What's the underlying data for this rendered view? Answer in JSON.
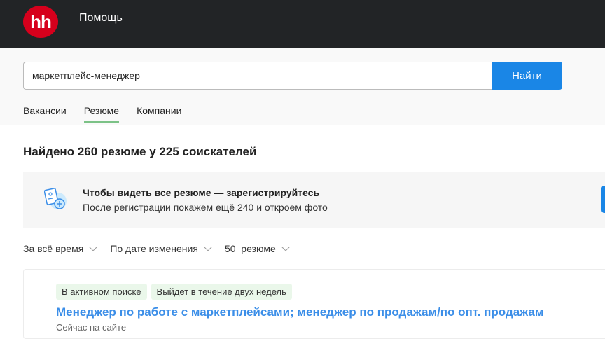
{
  "header": {
    "logo": "hh",
    "help": "Помощь"
  },
  "search": {
    "value": "маркетплейс-менеджер",
    "button": "Найти"
  },
  "tabs": [
    {
      "label": "Вакансии"
    },
    {
      "label": "Резюме",
      "active": true
    },
    {
      "label": "Компании"
    }
  ],
  "found": "Найдено 260 резюме у 225 соискателей",
  "banner": {
    "title": "Чтобы видеть все резюме — зарегистрируйтесь",
    "subtitle": "После регистрации покажем ещё 240 и откроем фото"
  },
  "filters": [
    "За всё время",
    "По дате изменения",
    "50  резюме"
  ],
  "resume": {
    "badges": [
      "В активном поиске",
      "Выйдет в течение двух недель"
    ],
    "title": "Менеджер по работе с маркетплейсами; менеджер по продажам/по опт. продажам",
    "status": "Сейчас на сайте"
  }
}
